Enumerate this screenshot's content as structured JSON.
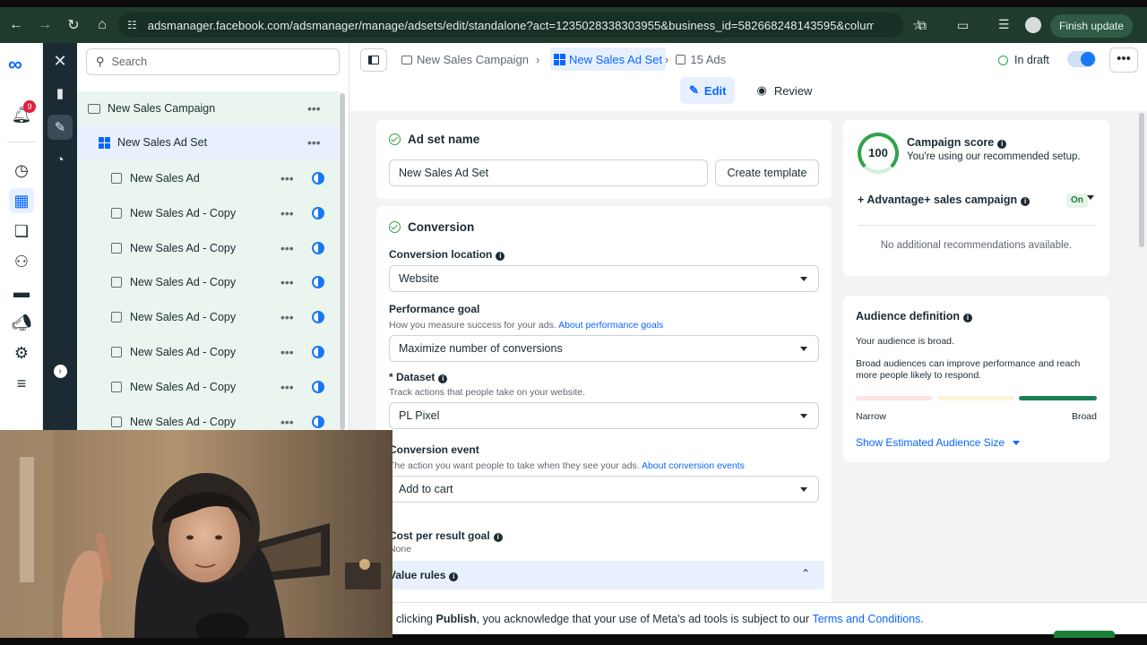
{
  "browser": {
    "url": "adsmanager.facebook.com/adsmanager/manage/adsets/edit/standalone?act=1235028338303955&business_id=582668248143595&column...",
    "finish_update": "Finish update"
  },
  "left_rail": {
    "notification_count": "9"
  },
  "tree": {
    "search_placeholder": "Search",
    "campaign": "New Sales Campaign",
    "ad_set": "New Sales Ad Set",
    "ads": [
      "New Sales Ad",
      "New Sales Ad - Copy",
      "New Sales Ad - Copy",
      "New Sales Ad - Copy",
      "New Sales Ad - Copy",
      "New Sales Ad - Copy",
      "New Sales Ad - Copy",
      "New Sales Ad - Copy"
    ]
  },
  "header": {
    "breadcrumb_campaign": "New Sales Campaign",
    "breadcrumb_adset": "New Sales Ad Set",
    "breadcrumb_ads": "15 Ads",
    "status": "In draft",
    "edit_label": "Edit",
    "review_label": "Review"
  },
  "ad_set_name": {
    "heading": "Ad set name",
    "value": "New Sales Ad Set",
    "create_template": "Create template"
  },
  "conversion": {
    "heading": "Conversion",
    "location_label": "Conversion location",
    "location_value": "Website",
    "goal_label": "Performance goal",
    "goal_help": "How you measure success for your ads.",
    "goal_help_link": "About performance goals",
    "goal_value": "Maximize number of conversions",
    "dataset_label": "* Dataset",
    "dataset_help": "Track actions that people take on your website.",
    "dataset_value": "PL Pixel",
    "event_label": "Conversion event",
    "event_help": "The action you want people to take when they see your ads.",
    "event_help_link": "About conversion events",
    "event_value": "Add to cart",
    "cost_label": "Cost per result goal",
    "cost_value": "None",
    "value_rules_label": "Value rules"
  },
  "campaign_score": {
    "score": "100",
    "title": "Campaign score",
    "subtitle": "You're using our recommended setup.",
    "advantage_label": "Advantage+ sales campaign",
    "advantage_state": "On",
    "no_recs": "No additional recommendations available."
  },
  "audience": {
    "title": "Audience definition",
    "broad_line": "Your audience is broad.",
    "broad_explain": "Broad audiences can improve performance and reach more people likely to respond.",
    "narrow": "Narrow",
    "broad": "Broad",
    "show_size": "Show Estimated Audience Size"
  },
  "footer": {
    "prefix": "clicking",
    "publish_word": "Publish",
    "middle": ", you acknowledge that your use of Meta's ad tools is subject to our",
    "terms_link": "Terms and Conditions",
    "suffix": "."
  },
  "colors": {
    "accent": "#0866ff",
    "success": "#31a24c",
    "chrome": "#1f3b2e"
  }
}
